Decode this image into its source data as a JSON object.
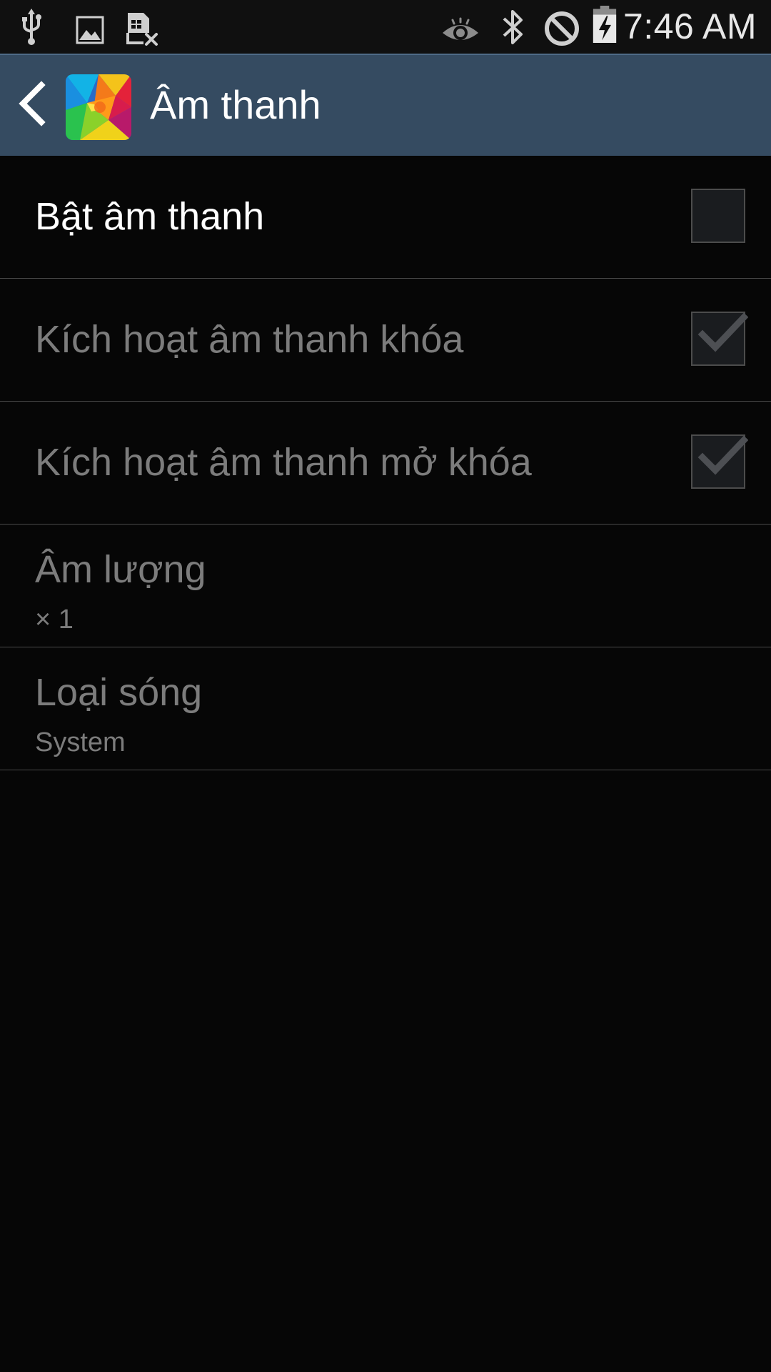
{
  "status_bar": {
    "time": "7:46 AM",
    "left_icons": [
      "usb-icon",
      "image-icon",
      "sim-card-off-icon"
    ],
    "right_icons": [
      "eye-icon",
      "bluetooth-icon",
      "blocked-icon",
      "battery-charging-icon"
    ]
  },
  "action_bar": {
    "title": "Âm thanh",
    "back_icon": "back-chevron-icon",
    "app_icon": "app-colorful-icon"
  },
  "settings": [
    {
      "title": "Bật âm thanh",
      "checked": false,
      "enabled": true
    },
    {
      "title": "Kích hoạt âm thanh khóa",
      "checked": true,
      "enabled": false
    },
    {
      "title": "Kích hoạt âm thanh mở khóa",
      "checked": true,
      "enabled": false
    },
    {
      "title": "Âm lượng",
      "summary": "× 1",
      "enabled": false
    },
    {
      "title": "Loại sóng",
      "summary": "System",
      "enabled": false
    }
  ],
  "colors": {
    "background": "#060606",
    "action_bar": "#354b61",
    "status_bar": "#101010",
    "text_enabled": "#ffffff",
    "text_disabled": "#7c7c7c",
    "divider": "#4a4a4a"
  }
}
